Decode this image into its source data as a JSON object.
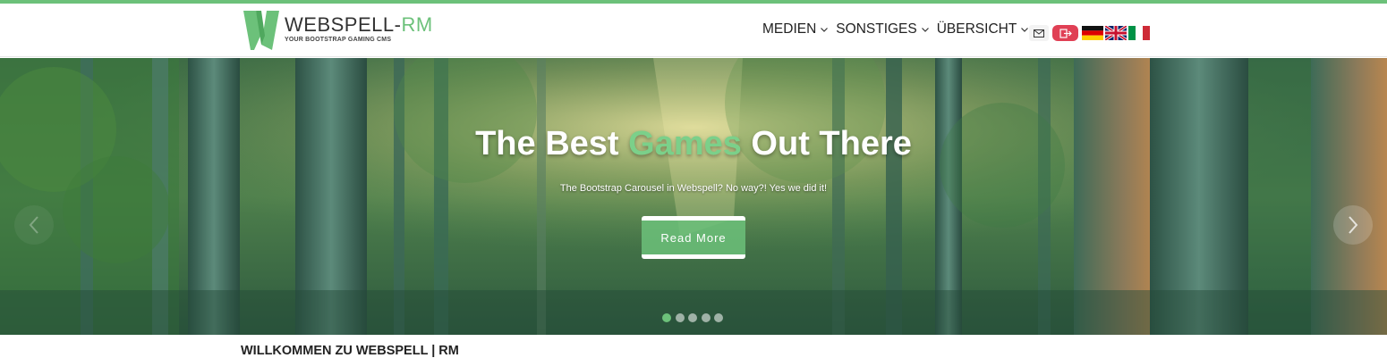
{
  "brand": {
    "title_main": "WEBSPELL-",
    "title_accent": "RM",
    "tagline": "YOUR BOOTSTRAP GAMING CMS",
    "accent_color": "#6cc17a"
  },
  "nav": {
    "items": [
      {
        "label": "MEDIEN"
      },
      {
        "label": "SONSTIGES"
      },
      {
        "label": "ÜBERSICHT"
      }
    ]
  },
  "header_icons": {
    "mail_icon": "envelope-icon",
    "logout_icon": "logout-icon",
    "logout_color": "#e04055",
    "flags": [
      "flag-germany-icon",
      "flag-uk-icon",
      "flag-italy-icon"
    ]
  },
  "hero": {
    "title_part1": "The Best ",
    "title_highlight": "Games",
    "title_part2": " Out There",
    "subtitle": "The Bootstrap Carousel in Webspell? No way?! Yes we did it!",
    "button_label": "Read More",
    "slide_count": 5,
    "active_slide": 1
  },
  "content": {
    "welcome_heading": "WILLKOMMEN ZU WEBSPELL | RM"
  }
}
